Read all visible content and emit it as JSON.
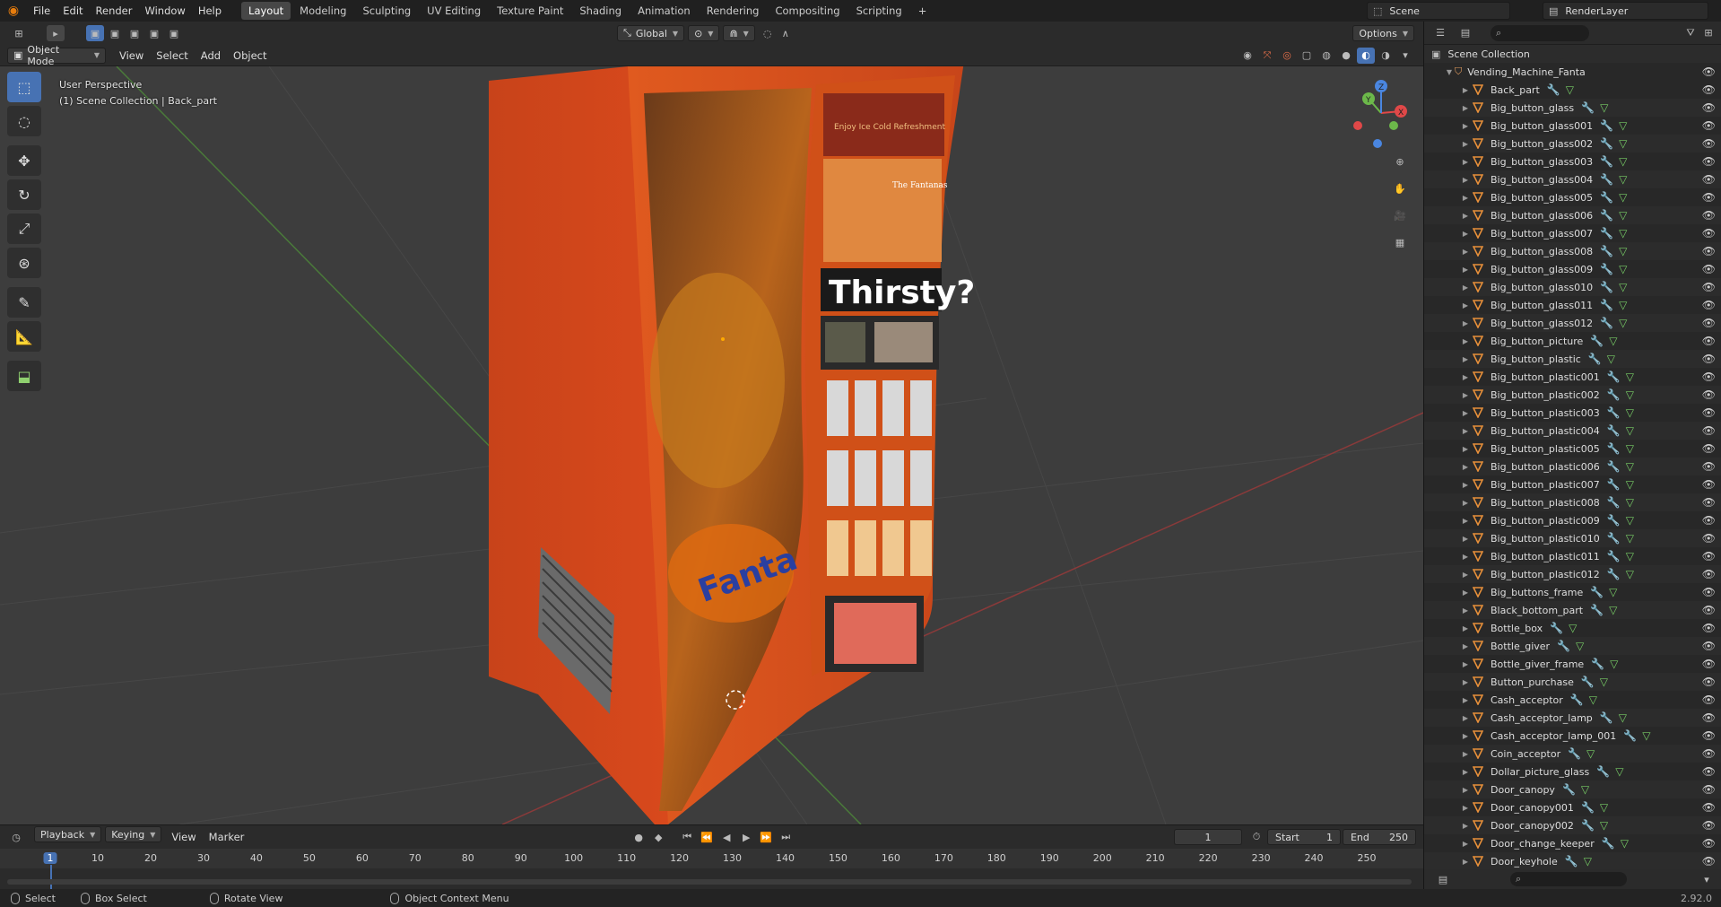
{
  "topbar": {
    "menus": [
      "File",
      "Edit",
      "Render",
      "Window",
      "Help"
    ],
    "workspaces": [
      "Layout",
      "Modeling",
      "Sculpting",
      "UV Editing",
      "Texture Paint",
      "Shading",
      "Animation",
      "Rendering",
      "Compositing",
      "Scripting"
    ],
    "active_workspace": "Layout",
    "add_workspace": "+",
    "scene_name": "Scene",
    "view_layer": "RenderLayer"
  },
  "viewport_header": {
    "mode": "Object Mode",
    "menus": [
      "View",
      "Select",
      "Add",
      "Object"
    ],
    "orientation": "Global",
    "options_label": "Options"
  },
  "viewport": {
    "view_name": "User Perspective",
    "collection_path": "(1) Scene Collection | Back_part",
    "gizmo_axes": {
      "x": "X",
      "y": "Y",
      "z": "Z"
    },
    "scene_text": {
      "thirsty": "Thirsty?",
      "brand": "Fanta",
      "tagline": "Enjoy Ice Cold Refreshment",
      "poster_title": "The Fantanas"
    },
    "colors": {
      "machine_orange": "#d8491c",
      "background": "#3d3d3d",
      "grid": "#474747",
      "x_axis": "#8a3a3a",
      "y_axis": "#4a7a3a"
    }
  },
  "outliner": {
    "root": "Scene Collection",
    "collection": "Vending_Machine_Fanta",
    "items": [
      "Back_part",
      "Big_button_glass",
      "Big_button_glass001",
      "Big_button_glass002",
      "Big_button_glass003",
      "Big_button_glass004",
      "Big_button_glass005",
      "Big_button_glass006",
      "Big_button_glass007",
      "Big_button_glass008",
      "Big_button_glass009",
      "Big_button_glass010",
      "Big_button_glass011",
      "Big_button_glass012",
      "Big_button_picture",
      "Big_button_plastic",
      "Big_button_plastic001",
      "Big_button_plastic002",
      "Big_button_plastic003",
      "Big_button_plastic004",
      "Big_button_plastic005",
      "Big_button_plastic006",
      "Big_button_plastic007",
      "Big_button_plastic008",
      "Big_button_plastic009",
      "Big_button_plastic010",
      "Big_button_plastic011",
      "Big_button_plastic012",
      "Big_buttons_frame",
      "Black_bottom_part",
      "Bottle_box",
      "Bottle_giver",
      "Bottle_giver_frame",
      "Button_purchase",
      "Cash_acceptor",
      "Cash_acceptor_lamp",
      "Cash_acceptor_lamp_001",
      "Coin_acceptor",
      "Dollar_picture_glass",
      "Door_canopy",
      "Door_canopy001",
      "Door_canopy002",
      "Door_change_keeper",
      "Door_keyhole"
    ]
  },
  "timeline": {
    "menus": [
      "Playback",
      "Keying",
      "View",
      "Marker"
    ],
    "current_frame": "1",
    "start_label": "Start",
    "start_value": "1",
    "end_label": "End",
    "end_value": "250",
    "ticks": [
      "1",
      "10",
      "20",
      "30",
      "40",
      "50",
      "60",
      "70",
      "80",
      "90",
      "100",
      "110",
      "120",
      "130",
      "140",
      "150",
      "160",
      "170",
      "180",
      "190",
      "200",
      "210",
      "220",
      "230",
      "240",
      "250"
    ]
  },
  "statusbar": {
    "select": "Select",
    "box_select": "Box Select",
    "rotate_view": "Rotate View",
    "context_menu": "Object Context Menu",
    "version": "2.92.0"
  }
}
